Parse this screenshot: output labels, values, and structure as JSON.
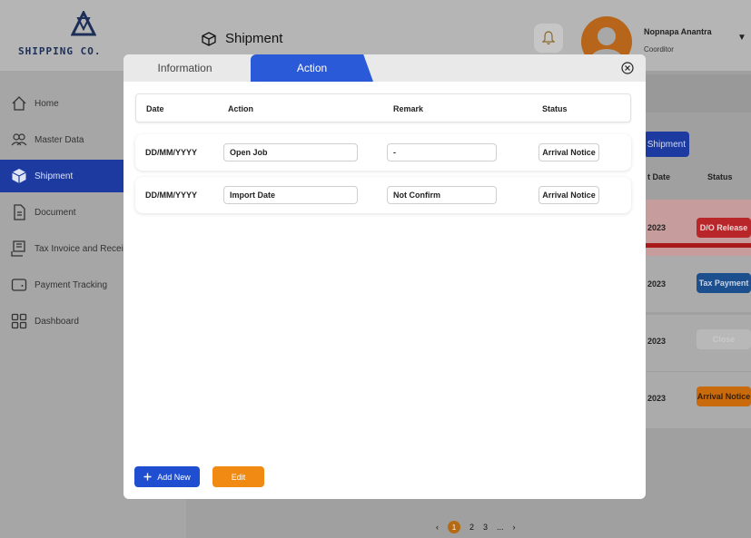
{
  "brand": {
    "name": "SHIPPING CO."
  },
  "header": {
    "title": "Shipment"
  },
  "user": {
    "name": "Nopnapa Anantra",
    "role": "Coorditor"
  },
  "sidebar": {
    "items": [
      {
        "label": "Home",
        "icon": "home-icon"
      },
      {
        "label": "Master Data",
        "icon": "users-icon"
      },
      {
        "label": "Shipment",
        "icon": "box-icon",
        "active": true
      },
      {
        "label": "Document",
        "icon": "document-icon"
      },
      {
        "label": "Tax Invoice and Receipt",
        "icon": "receipt-icon"
      },
      {
        "label": "Payment Tracking",
        "icon": "wallet-icon"
      },
      {
        "label": "Dashboard",
        "icon": "dashboard-icon"
      }
    ]
  },
  "background": {
    "new_button": "Shipment",
    "columns": {
      "date": "t Date",
      "status": "Status"
    },
    "rows": [
      {
        "date": "2023",
        "status": "D/O Release",
        "color": "#d41c1c"
      },
      {
        "date": "2023",
        "status": "Tax Payment",
        "color": "#1d62b8"
      },
      {
        "date": "2023",
        "status": "Close",
        "color": "#c9c9c9"
      },
      {
        "date": "2023",
        "status": "Arrival Notice",
        "color": "#f07d0c"
      }
    ],
    "pagination": {
      "prev": "‹",
      "pages": [
        "1",
        "2",
        "3",
        "..."
      ],
      "next": "›"
    }
  },
  "modal": {
    "tabs": {
      "information": "Information",
      "action": "Action"
    },
    "columns": {
      "date": "Date",
      "action": "Action",
      "remark": "Remark",
      "status": "Status"
    },
    "rows": [
      {
        "date": "DD/MM/YYYY",
        "action": "Open Job",
        "remark": "-",
        "status": "Arrival Notice"
      },
      {
        "date": "DD/MM/YYYY",
        "action": "Import Date",
        "remark": "Not Confirm",
        "status": "Arrival Notice"
      }
    ],
    "buttons": {
      "add": "Add New",
      "edit": "Edit"
    }
  },
  "colors": {
    "primary": "#1f4fd0",
    "accent": "#f08a12",
    "tab_active": "#2a5ad8"
  }
}
